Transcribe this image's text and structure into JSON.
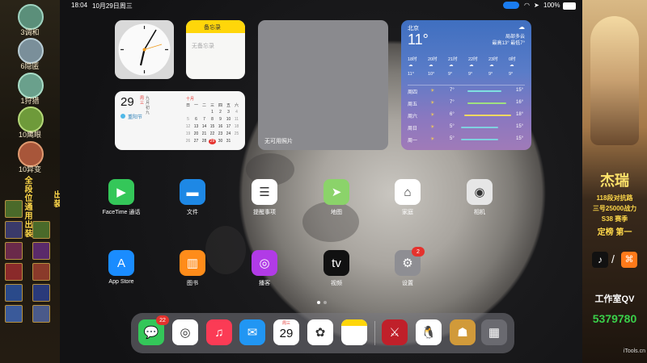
{
  "status_bar": {
    "time": "18:04",
    "date": "10月29日周三",
    "battery": "100%"
  },
  "left_panel": {
    "badges": [
      {
        "label": "3调和",
        "color": "#5b8f7a"
      },
      {
        "label": "6隐匿",
        "color": "#7a8f9a"
      },
      {
        "label": "1狩猎",
        "color": "#6aa08c"
      },
      {
        "label": "10鹰眼",
        "color": "#6e9a3a"
      },
      {
        "label": "10异变",
        "color": "#a8563a"
      }
    ],
    "vertical_text_1": "全段位通用出装",
    "vertical_text_2": "出装"
  },
  "widgets": {
    "notes": {
      "title": "备忘录",
      "body": "无备忘录"
    },
    "photos": {
      "label": "无可用照片"
    },
    "calendar": {
      "day": "29",
      "weekday_short": "周三",
      "lunar": "九月初九",
      "event": "重阳节",
      "month": "十月",
      "weekdays": [
        "日",
        "一",
        "二",
        "三",
        "四",
        "五",
        "六"
      ],
      "rows": [
        [
          "",
          "",
          "",
          "1",
          "2",
          "3",
          "4"
        ],
        [
          "5",
          "6",
          "7",
          "8",
          "9",
          "10",
          "11"
        ],
        [
          "12",
          "13",
          "14",
          "15",
          "16",
          "17",
          "18"
        ],
        [
          "19",
          "20",
          "21",
          "22",
          "23",
          "24",
          "25"
        ],
        [
          "26",
          "27",
          "28",
          "29",
          "30",
          "31",
          ""
        ]
      ]
    },
    "weather": {
      "city": "北京",
      "temp": "11°",
      "condition": "局部多云",
      "range": "最高13° 最低7°",
      "hours": [
        {
          "time": "18时",
          "temp": "11°"
        },
        {
          "time": "20时",
          "temp": "10°"
        },
        {
          "time": "21时",
          "temp": "9°"
        },
        {
          "time": "22时",
          "temp": "9°"
        },
        {
          "time": "23时",
          "temp": "9°"
        },
        {
          "time": "0时",
          "temp": "9°"
        }
      ],
      "days": [
        {
          "day": "周四",
          "low": "7°",
          "high": "15°"
        },
        {
          "day": "周五",
          "low": "7°",
          "high": "16°"
        },
        {
          "day": "周六",
          "low": "6°",
          "high": "18°"
        },
        {
          "day": "周日",
          "low": "5°",
          "high": "15°"
        },
        {
          "day": "周一",
          "low": "5°",
          "high": "15°"
        }
      ]
    }
  },
  "apps": [
    {
      "label": "FaceTime 通话",
      "color": "#34c759",
      "glyph": "▶",
      "icon": "facetime-icon"
    },
    {
      "label": "文件",
      "color": "#1e88e5",
      "glyph": "▬",
      "icon": "files-icon"
    },
    {
      "label": "提醒事项",
      "color": "#ffffff",
      "glyph": "☰",
      "icon": "reminders-icon"
    },
    {
      "label": "地图",
      "color": "#8bd36a",
      "glyph": "➤",
      "icon": "maps-icon"
    },
    {
      "label": "家庭",
      "color": "#ffffff",
      "glyph": "⌂",
      "icon": "home-icon"
    },
    {
      "label": "相机",
      "color": "#e6e6e6",
      "glyph": "◉",
      "icon": "camera-icon"
    },
    {
      "label": "App Store",
      "color": "#1a8cff",
      "glyph": "A",
      "icon": "app-store-icon"
    },
    {
      "label": "图书",
      "color": "#ff8c1a",
      "glyph": "▥",
      "icon": "books-icon"
    },
    {
      "label": "播客",
      "color": "#b13be6",
      "glyph": "◎",
      "icon": "podcasts-icon"
    },
    {
      "label": "视频",
      "color": "#111111",
      "glyph": "tv",
      "icon": "apple-tv-icon"
    },
    {
      "label": "设置",
      "color": "#8e8e93",
      "glyph": "⚙",
      "icon": "settings-icon",
      "badge": "2"
    }
  ],
  "dock": [
    {
      "name": "messages",
      "color": "#34c759",
      "glyph": "💬",
      "icon": "messages-icon",
      "badge": "22"
    },
    {
      "name": "safari",
      "color": "#ffffff",
      "glyph": "◎",
      "icon": "safari-icon"
    },
    {
      "name": "music",
      "color": "#fb3b55",
      "glyph": "♫",
      "icon": "music-icon"
    },
    {
      "name": "mail",
      "color": "#2196f3",
      "glyph": "✉",
      "icon": "mail-icon"
    },
    {
      "name": "calendar",
      "color": "#ffffff",
      "glyph": "29",
      "icon": "calendar-icon",
      "small": "周三"
    },
    {
      "name": "photos",
      "color": "#ffffff",
      "glyph": "✿",
      "icon": "photos-icon"
    },
    {
      "name": "notes",
      "color": "#ffffff",
      "glyph": "",
      "icon": "notes-icon"
    },
    {
      "name": "game",
      "color": "#c0202a",
      "glyph": "⚔",
      "icon": "game-app-icon"
    },
    {
      "name": "qq",
      "color": "#ffffff",
      "glyph": "🐧",
      "icon": "qq-icon"
    },
    {
      "name": "honor-of-kings",
      "color": "#d19a3a",
      "glyph": "☗",
      "icon": "honor-of-kings-icon"
    },
    {
      "name": "app-library",
      "color": "#6a6a70",
      "glyph": "▦",
      "icon": "app-library-icon"
    }
  ],
  "right_panel": {
    "name": "杰瑞",
    "line1": "118段对抗路",
    "line2": "三号25000战力",
    "line3": "S38 赛季",
    "line4": "定榜 第一",
    "studio": "工作室QV",
    "number": "5379780",
    "watermark": "iTools.cn"
  }
}
